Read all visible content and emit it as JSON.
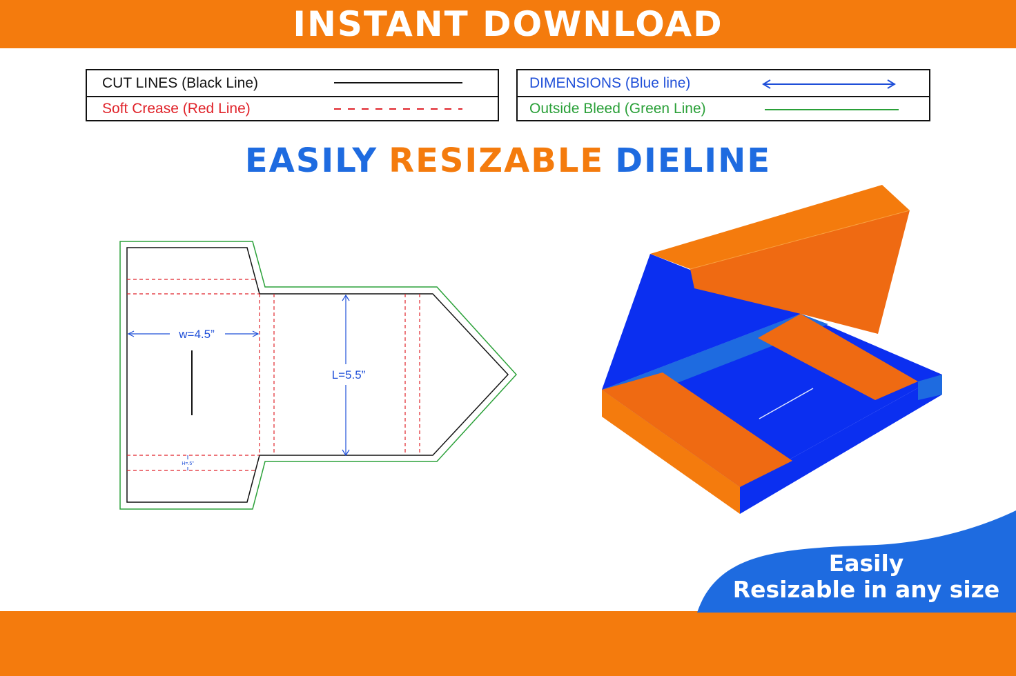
{
  "banner": {
    "title": "INSTANT DOWNLOAD"
  },
  "legend": {
    "cut_lines": "CUT LINES (Black Line)",
    "soft_crease": "Soft Crease (Red Line)",
    "dimensions": "DIMENSIONS (Blue line)",
    "outside_bleed": "Outside Bleed (Green Line)"
  },
  "headline": {
    "word1": "EASILY",
    "word2": "RESIZABLE",
    "word3": "DIELINE"
  },
  "dieline": {
    "width_label": "w=4.5”",
    "length_label": "L=5.5”",
    "height_label": "H=.5”"
  },
  "badge": {
    "line1": "Easily",
    "line2": "Resizable in any size"
  },
  "colors": {
    "orange": "#f47b0d",
    "blue": "#1e6be0",
    "royal_blue": "#0b2ff0",
    "cut": "#111111",
    "crease": "#e0232a",
    "dimension": "#1f4fd8",
    "bleed": "#2aa038"
  }
}
